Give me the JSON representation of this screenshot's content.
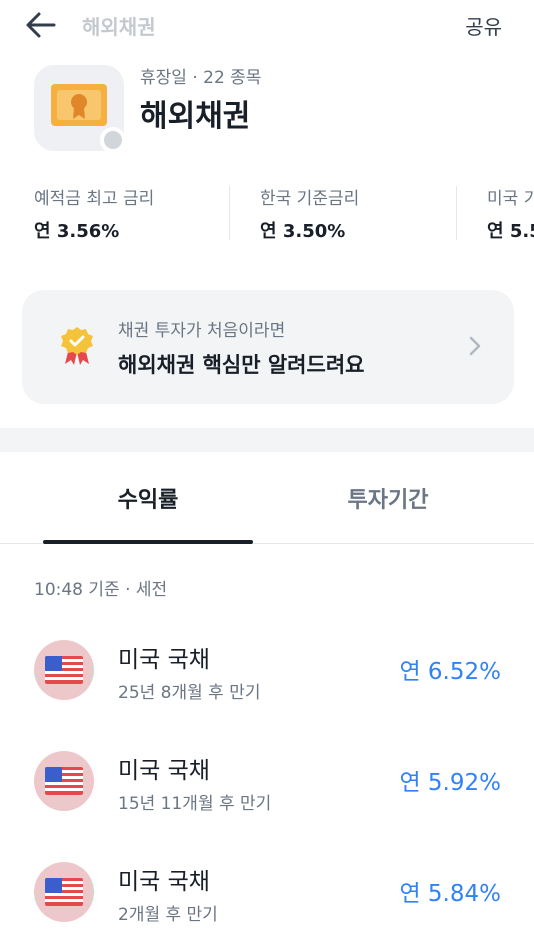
{
  "topbar": {
    "title": "해외채권",
    "share_label": "공유"
  },
  "header": {
    "meta": "휴장일 · 22 종목",
    "title": "해외채권"
  },
  "rates": [
    {
      "label": "예적금 최고 금리",
      "value": "연 3.56%"
    },
    {
      "label": "한국 기준금리",
      "value": "연 3.50%"
    },
    {
      "label": "미국 기",
      "value": "연 5.5"
    }
  ],
  "promo": {
    "subtitle": "채권 투자가 처음이라면",
    "title": "해외채권 핵심만 알려드려요"
  },
  "tabs": [
    {
      "label": "수익률",
      "active": true
    },
    {
      "label": "투자기간",
      "active": false
    }
  ],
  "timestamp": "10:48 기준 · 세전",
  "bonds": [
    {
      "name": "미국 국채",
      "maturity": "25년 8개월 후 만기",
      "rate": "연 6.52%"
    },
    {
      "name": "미국 국채",
      "maturity": "15년 11개월 후 만기",
      "rate": "연 5.92%"
    },
    {
      "name": "미국 국채",
      "maturity": "2개월 후 만기",
      "rate": "연 5.84%"
    }
  ],
  "colors": {
    "accent": "#3182f6",
    "text_primary": "#191f28",
    "text_secondary": "#6b7684"
  },
  "icons": {
    "back": "arrow-left-icon",
    "chevron": "chevron-right-icon",
    "flag": "us-flag-icon",
    "badge": "award-badge-icon"
  }
}
